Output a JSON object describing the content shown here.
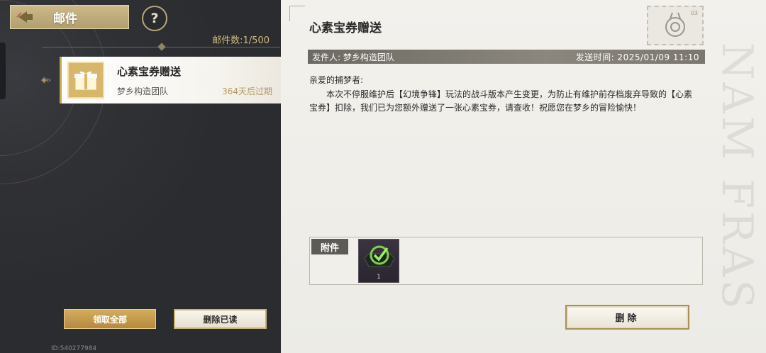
{
  "header": {
    "title": "邮件",
    "help_label": "?"
  },
  "mailbox": {
    "count_label": "邮件数:1/500"
  },
  "mail_list": [
    {
      "title": "心素宝券赠送",
      "sender": "梦乡构造团队",
      "expire": "364天后过期"
    }
  ],
  "actions": {
    "claim_all": "领取全部",
    "delete_read": "删除已读",
    "delete": "删除"
  },
  "player": {
    "id_label": "ID:540277984"
  },
  "detail": {
    "title": "心素宝券赠送",
    "sender_label": "发件人: 梦乡构造团队",
    "time_label": "发送时间:  2025/01/09 11:10",
    "stamp_no": "03",
    "greeting": "亲爱的捕梦者:",
    "body": "本次不停服维护后【幻境争锋】玩法的战斗版本产生变更，为防止有维护前存档废弃导致的【心素宝券】扣除，我们已为您额外赠送了一张心素宝券，请查收！祝愿您在梦乡的冒险愉快！",
    "attachments_label": "附件",
    "attachments": [
      {
        "icon": "coupon-check-icon",
        "quantity": "1"
      }
    ]
  },
  "colors": {
    "accent_gold": "#c9aa56",
    "panel_dark": "#2e2f33",
    "paper": "#f3f1ec"
  }
}
